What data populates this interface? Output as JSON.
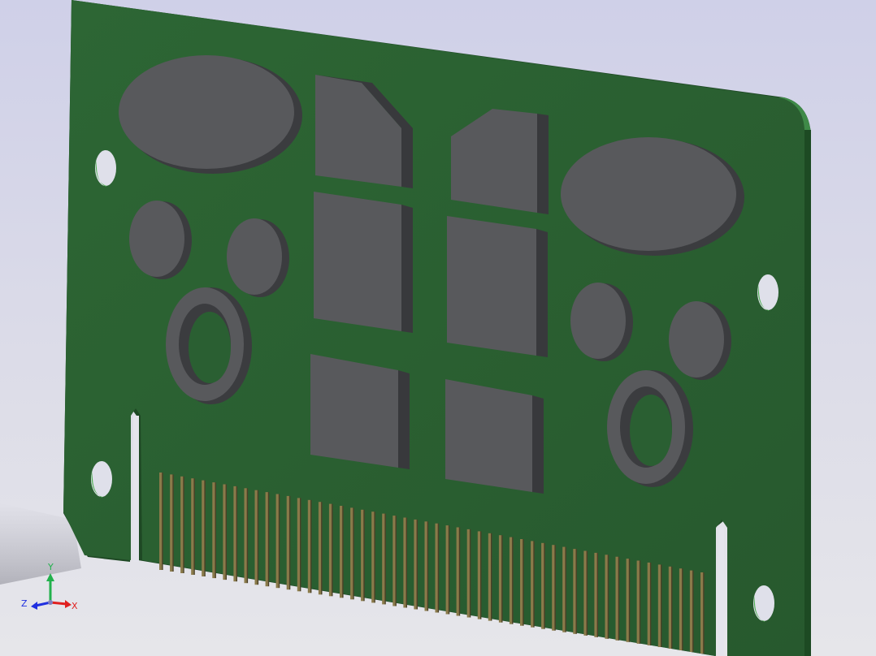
{
  "viewport": {
    "background_top": "#cfd0e8",
    "background_bottom": "#e6e6ea"
  },
  "model": {
    "pcb_color": "#2a5f32",
    "pcb_edge_color": "#1a3a1f",
    "component_color": "#58595c",
    "component_side_color": "#3a3b3e",
    "gold_finger_color": "#8a7a4a",
    "gold_finger_count": 52
  },
  "triad": {
    "y_label": "Y",
    "x_label": "X",
    "z_label": "Z",
    "y_color": "#22b14c",
    "x_color": "#e02020",
    "z_color": "#2030e0"
  }
}
